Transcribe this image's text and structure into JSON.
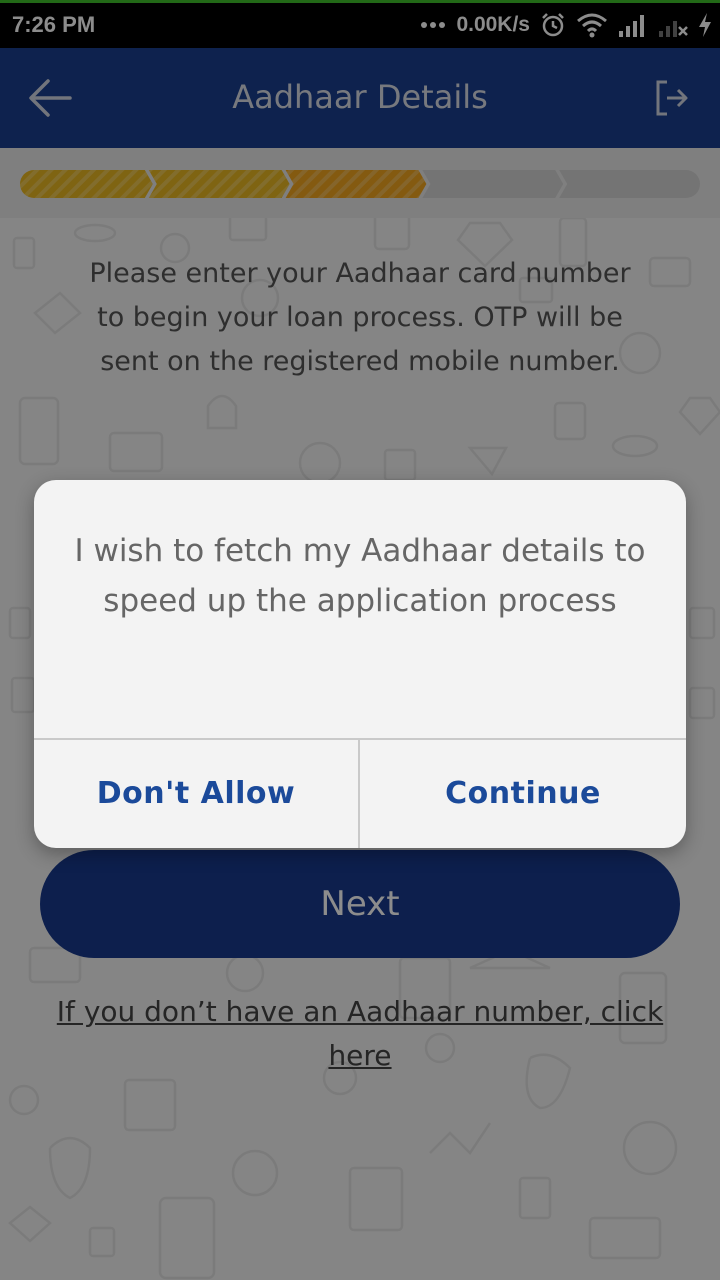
{
  "status_bar": {
    "time": "7:26 PM",
    "network_speed": "0.00K/s",
    "icons": [
      "more-dots-icon",
      "alarm-icon",
      "wifi-icon",
      "signal-icon",
      "signal-no-sim-icon",
      "charging-icon"
    ]
  },
  "app_bar": {
    "title": "Aadhaar Details",
    "back_icon": "arrow-left-icon",
    "logout_icon": "logout-icon"
  },
  "progress": {
    "total_steps": 5,
    "completed_steps": 2,
    "current_step": 3,
    "colors": {
      "done": "#e8b622",
      "current": "#f0a51e",
      "pending": "#d4d4d4"
    }
  },
  "intro_text": "Please enter your Aadhaar card number to begin your loan process. OTP will be sent on the registered mobile number.",
  "next_label": "Next",
  "no_aadhaar_link": "If you don’t have an Aadhaar number, click here",
  "dialog": {
    "message": "I wish to fetch my Aadhaar details to speed up the application process",
    "deny_label": "Don't Allow",
    "confirm_label": "Continue"
  },
  "colors": {
    "app_bar": "#1b3f8e",
    "primary_button": "#183a8c",
    "dialog_button_text": "#1b4a9a"
  }
}
